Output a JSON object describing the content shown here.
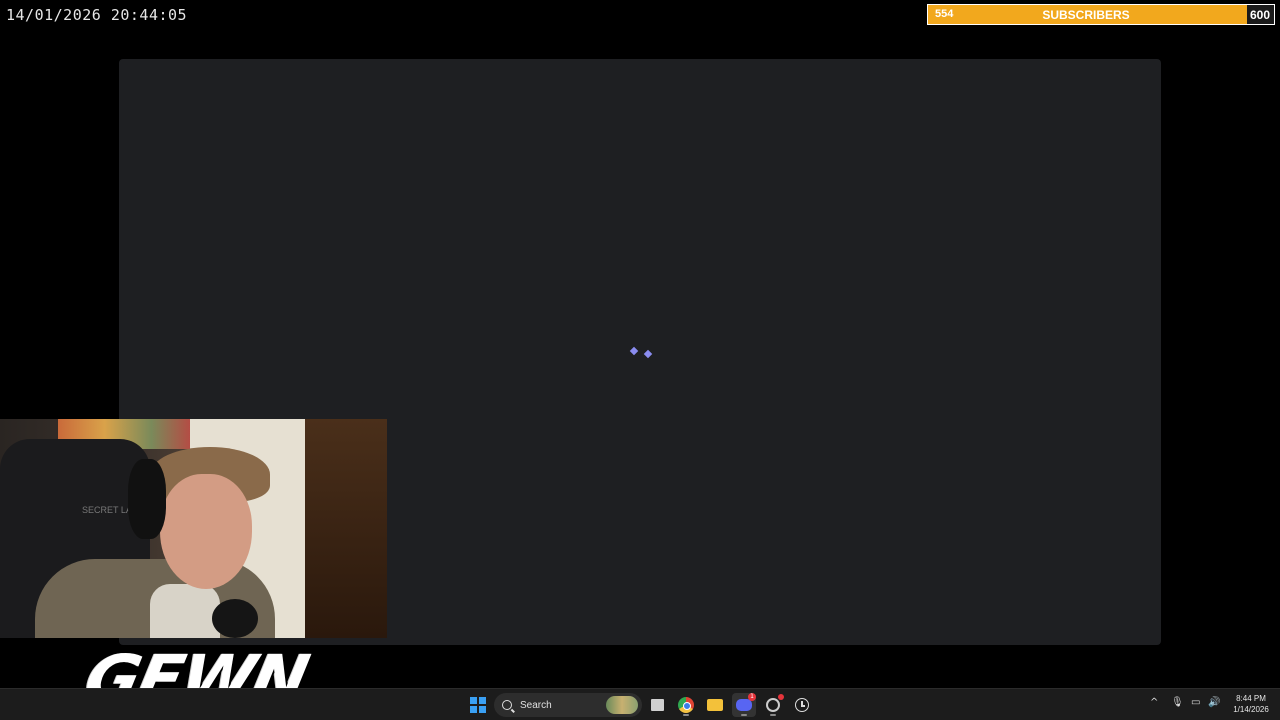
{
  "overlay": {
    "datetime": "14/01/2026 20:44:05",
    "subscriber_goal": {
      "current": "554",
      "label": "SUBSCRIBERS",
      "goal": "600",
      "progress_percent": 92.3,
      "fill_color": "#f2a81d"
    },
    "streamer_logo": "GEWN"
  },
  "app_window": {
    "state": "loading",
    "background_color": "#1e1f22",
    "spinner_color": "#8a8cf0"
  },
  "webcam": {
    "chair_brand": "SECRET LAB"
  },
  "taskbar": {
    "search_label": "Search",
    "items": [
      {
        "icon": "windows-start-icon"
      },
      {
        "icon": "search-icon"
      },
      {
        "icon": "file-explorer-icon"
      },
      {
        "icon": "chrome-icon"
      },
      {
        "icon": "folder-icon"
      },
      {
        "icon": "discord-icon",
        "badge": "1"
      },
      {
        "icon": "app-icon"
      },
      {
        "icon": "clock-icon"
      }
    ],
    "tray": {
      "chevron": "^",
      "mic": "🎙",
      "network": "▭",
      "volume": "🔊",
      "time": "8:44 PM",
      "date": "1/14/2026"
    }
  }
}
